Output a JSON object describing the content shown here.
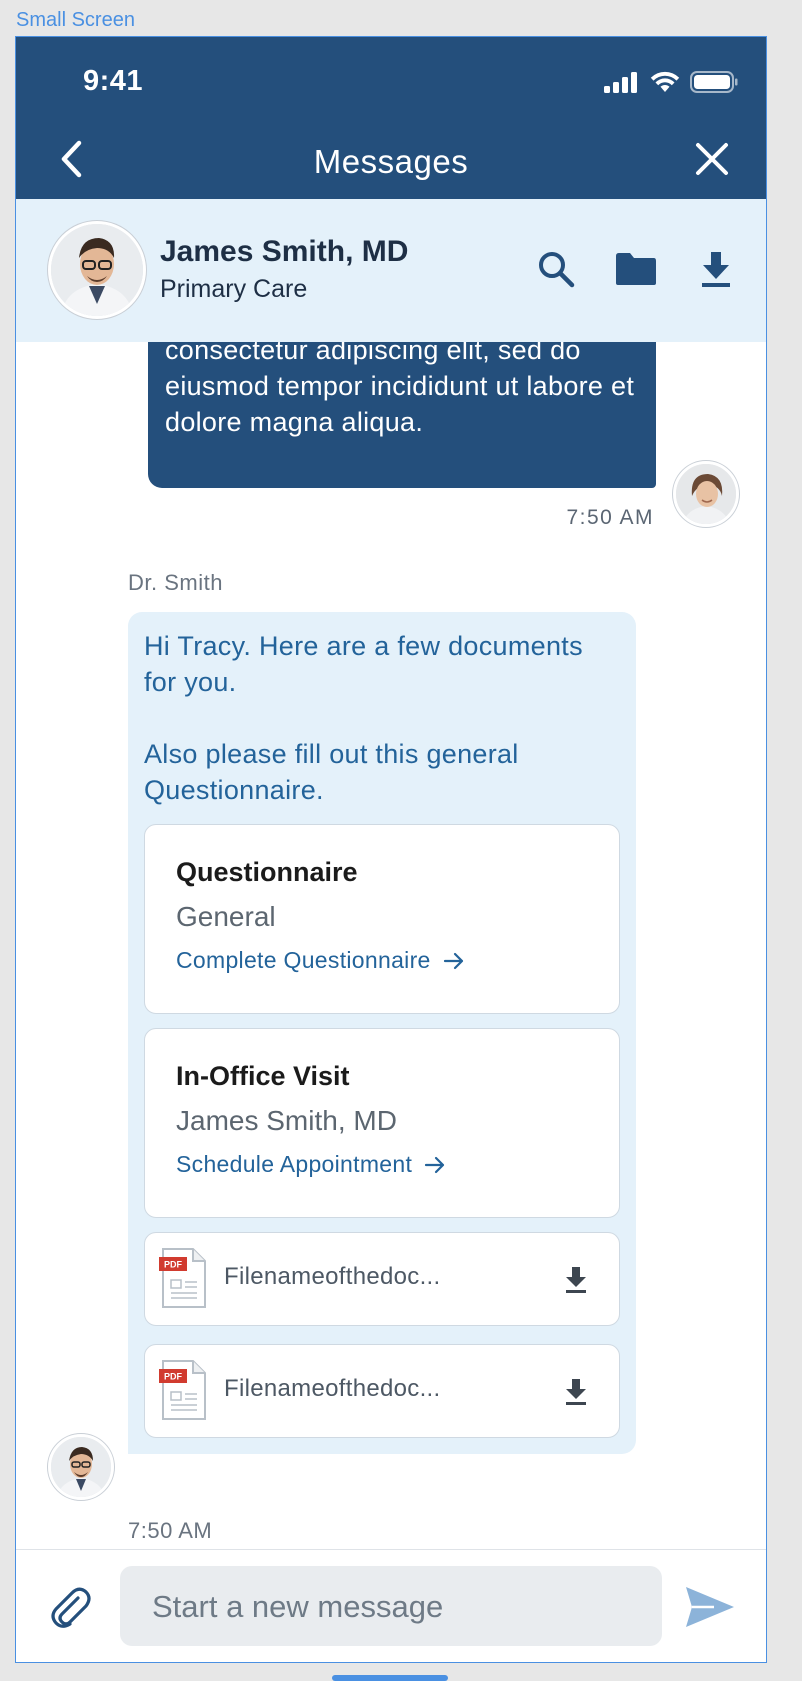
{
  "frame_label": "Small Screen",
  "status_bar": {
    "time": "9:41"
  },
  "nav": {
    "title": "Messages"
  },
  "contact": {
    "name": "James Smith, MD",
    "specialty": "Primary Care"
  },
  "messages": {
    "outgoing": {
      "text": "consectetur adipiscing elit, sed do eiusmod tempor incididunt ut labore et dolore magna aliqua.",
      "time": "7:50 AM"
    },
    "incoming": {
      "sender": "Dr. Smith",
      "text": "Hi Tracy. Here are a few documents for you.\n\nAlso please fill out this general Questionnaire.",
      "time": "7:50 AM",
      "cards": [
        {
          "title": "Questionnaire",
          "subtitle": "General",
          "link": "Complete Questionnaire"
        },
        {
          "title": "In-Office Visit",
          "subtitle": "James Smith, MD",
          "link": "Schedule Appointment"
        }
      ],
      "files": [
        {
          "icon_label": "PDF",
          "name": "Filenameofthedoc..."
        },
        {
          "icon_label": "PDF",
          "name": "Filenameofthedoc..."
        }
      ]
    }
  },
  "composer": {
    "placeholder": "Start a new message"
  },
  "icons": [
    "back-chevron-icon",
    "close-icon",
    "search-icon",
    "folder-icon",
    "download-icon",
    "paperclip-icon",
    "send-icon",
    "pdf-file-icon",
    "signal-icon",
    "wifi-icon",
    "battery-icon"
  ],
  "colors": {
    "primary": "#244f7c",
    "light_panel": "#e4f1fa",
    "link": "#23639a",
    "frame_outline": "#4a90e2"
  }
}
